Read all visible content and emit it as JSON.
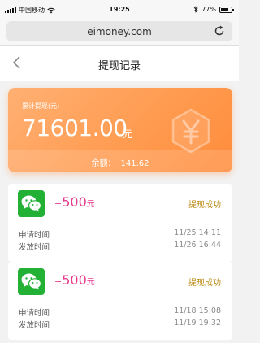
{
  "status_bar": {
    "carrier": "中国移动",
    "time": "19:25",
    "battery": "77%",
    "battery_level": 0.77
  },
  "browser": {
    "url": "eimoney.com",
    "reload_icon": "reload-icon"
  },
  "nav": {
    "back_icon": "back-chevron-icon",
    "title": "提现记录"
  },
  "summary": {
    "label": "累计提现(元)",
    "amount": "71601.00",
    "unit": "元",
    "balance_label": "余额：",
    "balance_value": "141.62",
    "emblem_icon": "yen-hexagon-icon"
  },
  "records": [
    {
      "icon": "wechat-icon",
      "sign": "+",
      "amount": "500",
      "unit": "元",
      "status": "提现成功",
      "apply_label": "申请时间",
      "apply_time": "11/25 14:11",
      "pay_label": "发放时间",
      "pay_time": "11/26 16:44"
    },
    {
      "icon": "wechat-icon",
      "sign": "+",
      "amount": "500",
      "unit": "元",
      "status": "提现成功",
      "apply_label": "申请时间",
      "apply_time": "11/18 15:08",
      "pay_label": "发放时间",
      "pay_time": "11/19 19:32"
    }
  ],
  "colors": {
    "card_orange": "#ff9a4e",
    "amount_pink": "#e33a8c",
    "success_gold": "#b8860b",
    "wechat_green": "#22b035"
  }
}
